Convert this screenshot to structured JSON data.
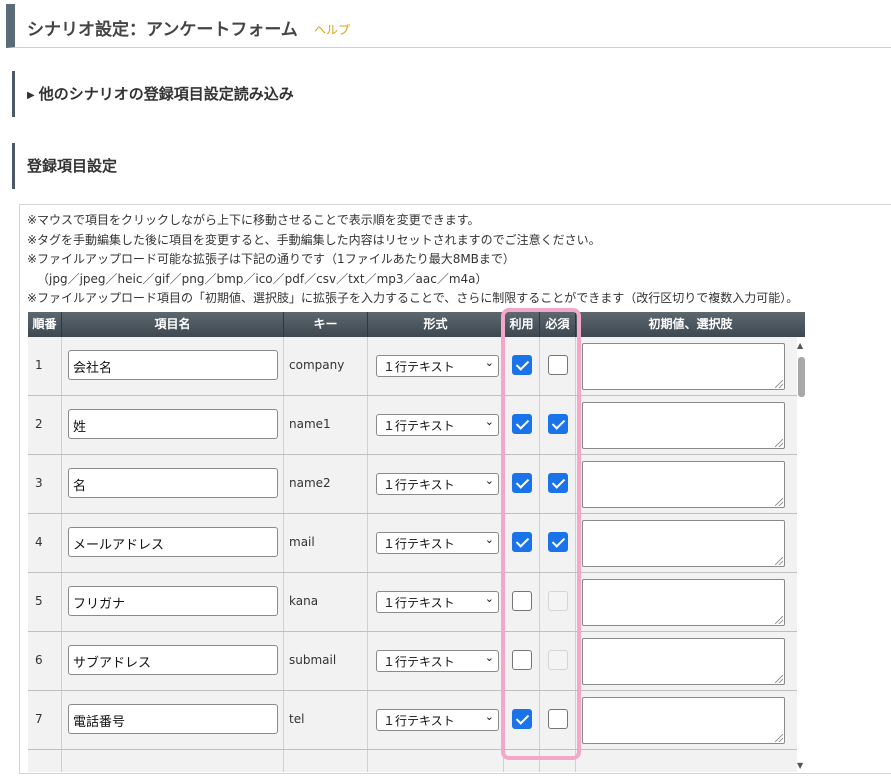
{
  "header": {
    "title": "シナリオ設定：アンケートフォーム",
    "help": "ヘルプ"
  },
  "sections": {
    "load_other": "他のシナリオの登録項目設定読み込み",
    "field_settings": "登録項目設定"
  },
  "notes": [
    "※マウスで項目をクリックしながら上下に移動させることで表示順を変更できます。",
    "※タグを手動編集した後に項目を変更すると、手動編集した内容はリセットされますのでご注意ください。",
    "※ファイルアップロード可能な拡張子は下記の通りです（1ファイルあたり最大8MBまで）",
    "（jpg／jpeg／heic／gif／png／bmp／ico／pdf／csv／txt／mp3／aac／m4a）",
    "※ファイルアップロード項目の「初期値、選択肢」に拡張子を入力することで、さらに制限することができます（改行区切りで複数入力可能）。"
  ],
  "table": {
    "columns": [
      "順番",
      "項目名",
      "キー",
      "形式",
      "利用",
      "必須",
      "初期値、選択肢"
    ],
    "rows": [
      {
        "num": "1",
        "name": "会社名",
        "key": "company",
        "format": "１行テキスト",
        "use": "checked",
        "required": "unchecked"
      },
      {
        "num": "2",
        "name": "姓",
        "key": "name1",
        "format": "１行テキスト",
        "use": "checked",
        "required": "checked"
      },
      {
        "num": "3",
        "name": "名",
        "key": "name2",
        "format": "１行テキスト",
        "use": "checked",
        "required": "checked"
      },
      {
        "num": "4",
        "name": "メールアドレス",
        "key": "mail",
        "format": "１行テキスト",
        "use": "checked",
        "required": "checked"
      },
      {
        "num": "5",
        "name": "フリガナ",
        "key": "kana",
        "format": "１行テキスト",
        "use": "unchecked",
        "required": "disabled"
      },
      {
        "num": "6",
        "name": "サブアドレス",
        "key": "submail",
        "format": "１行テキスト",
        "use": "unchecked",
        "required": "disabled"
      },
      {
        "num": "7",
        "name": "電話番号",
        "key": "tel",
        "format": "１行テキスト",
        "use": "checked",
        "required": "unchecked"
      }
    ]
  },
  "colors": {
    "accent": "#1a73e8",
    "highlight": "#f4a7c8",
    "help": "#d4a21a"
  }
}
